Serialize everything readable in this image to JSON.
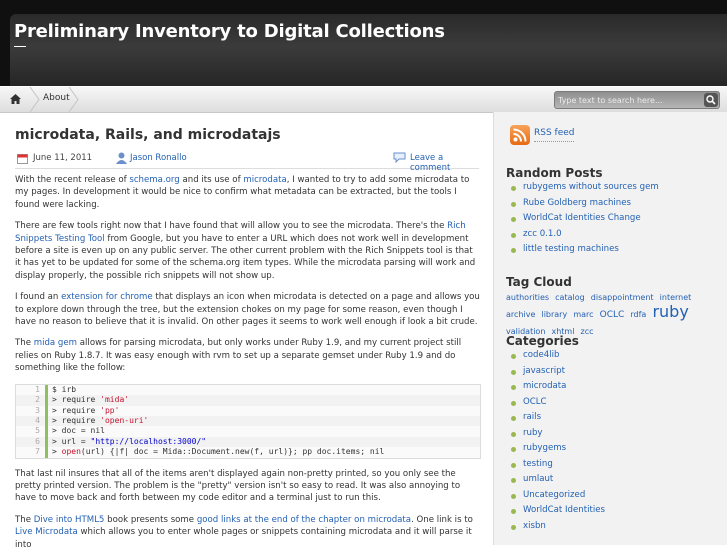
{
  "site": {
    "title": "Preliminary Inventory to Digital Collections"
  },
  "nav": {
    "home_icon": "home-icon",
    "about_label": "About"
  },
  "search": {
    "placeholder": "Type text to search here..."
  },
  "post": {
    "title": "microdata, Rails, and microdatajs",
    "date": "June 11, 2011",
    "author": "Jason Ronallo",
    "comment_label": "Leave a comment",
    "p1": [
      "With the recent release of ",
      "schema.org",
      " and its use of ",
      "microdata",
      ", I wanted to try to add some microdata to my pages. In development it would be nice to confirm what metadata can be extracted, but the tools I found were lacking."
    ],
    "p2": [
      "There are few tools right now that I have found that will allow you to see the microdata. There's the ",
      "Rich Snippets Testing Tool",
      " from Google, but you have to enter a URL which does not work well in development before a site is even up on any public server. The other current problem with the Rich Snippets tool is that it has yet to be updated for some of the schema.org item types. While the microdata parsing will work and display properly, the possible rich snippets will not show up."
    ],
    "p3": [
      "I found an ",
      "extension for chrome",
      " that displays an icon when microdata is detected on a page and allows you to explore down through the tree, but the extension chokes on my page for some reason, even though I have no reason to believe that it is invalid. On other pages it seems to work well enough if look a bit crude."
    ],
    "p4": [
      "The ",
      "mida gem",
      " allows for parsing microdata, but only works under Ruby 1.9, and my current project still relies on Ruby 1.8.7. It was easy enough with rvm to set up a separate gemset under Ruby 1.9 and do something like the follow:"
    ],
    "code": [
      {
        "n": "1",
        "pre": "$ irb",
        "str": "",
        "str_class": "",
        "post": ""
      },
      {
        "n": "2",
        "pre": "> require ",
        "str": "'mida'",
        "str_class": "str",
        "post": ""
      },
      {
        "n": "3",
        "pre": "> require ",
        "str": "'pp'",
        "str_class": "str",
        "post": ""
      },
      {
        "n": "4",
        "pre": "> require ",
        "str": "'open-uri'",
        "str_class": "str",
        "post": ""
      },
      {
        "n": "5",
        "pre": "> doc = nil",
        "str": "",
        "str_class": "",
        "post": ""
      },
      {
        "n": "6",
        "pre": "> url = ",
        "str": "\"http://localhost:3000/\"",
        "str_class": "str2",
        "post": ""
      },
      {
        "n": "7",
        "pre": "> ",
        "str": "open",
        "str_class": "str",
        "post": "(url) {|f| doc = Mida::Document.new(f, url)}; pp doc.items; nil"
      }
    ],
    "p5": "That last nil insures that all of the items aren't displayed again non-pretty printed, so you only see the pretty printed version. The problem is the \"pretty\" version isn't so easy to read. It was also annoying to have to move back and forth between my code editor and a terminal just to run this.",
    "p6": [
      "The ",
      "Dive into HTML5",
      " book presents some ",
      "good links at the end of the chapter on microdata",
      ". One link is to ",
      "Live Microdata",
      " which allows you to enter whole pages or snippets containing microdata and it will parse it into"
    ]
  },
  "sidebar": {
    "rss_label": "RSS feed",
    "random_posts_title": "Random Posts",
    "random_posts": [
      "rubygems without sources gem",
      "Rube Goldberg machines",
      "WorldCat Identities Change",
      "zcc 0.1.0",
      "little testing machines"
    ],
    "tag_cloud_title": "Tag Cloud",
    "tags": [
      {
        "t": "authorities",
        "s": "8px"
      },
      {
        "t": "catalog",
        "s": "8px"
      },
      {
        "t": "disappointment",
        "s": "8px"
      },
      {
        "t": "internet archive",
        "s": "8px"
      },
      {
        "t": "library",
        "s": "8px"
      },
      {
        "t": "marc",
        "s": "8px"
      },
      {
        "t": "OCLC",
        "s": "9px"
      },
      {
        "t": "rdfa",
        "s": "8px"
      },
      {
        "t": "ruby",
        "s": "16px"
      },
      {
        "t": "validation",
        "s": "8px"
      },
      {
        "t": "xhtml",
        "s": "8px"
      },
      {
        "t": "zcc",
        "s": "8px"
      }
    ],
    "categories_title": "Categories",
    "categories": [
      "code4lib",
      "javascript",
      "microdata",
      "OCLC",
      "rails",
      "ruby",
      "rubygems",
      "testing",
      "umlaut",
      "Uncategorized",
      "WorldCat Identities",
      "xisbn"
    ]
  },
  "colors": {
    "link": "#2461b3",
    "bullet": "#9ab850",
    "header": "#2f2f2f"
  }
}
